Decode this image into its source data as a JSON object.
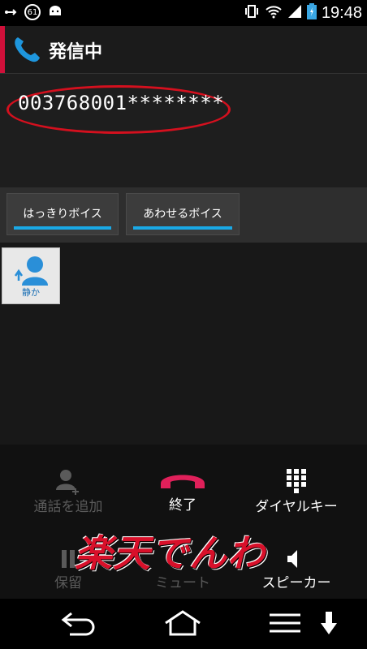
{
  "status_bar": {
    "time": "19:48",
    "notification_badge": "61",
    "icons": [
      "usb-icon",
      "android-icon",
      "vibrate-icon",
      "wifi-icon",
      "signal-icon",
      "battery-icon"
    ]
  },
  "header": {
    "title": "発信中",
    "icon": "phone-icon"
  },
  "call": {
    "number": "003768001********"
  },
  "voice_options": [
    {
      "label": "はっきりボイス"
    },
    {
      "label": "あわせるボイス"
    }
  ],
  "quiet": {
    "label": "静か"
  },
  "controls": {
    "add_call": "通話を追加",
    "end": "終了",
    "dialpad": "ダイヤルキー",
    "hold": "保留",
    "mute": "ミュート",
    "speaker": "スピーカー"
  },
  "watermark": "楽天でんわ",
  "colors": {
    "accent_red": "#d0103a",
    "blue": "#1aa9e6",
    "end_call": "#e0205a"
  }
}
